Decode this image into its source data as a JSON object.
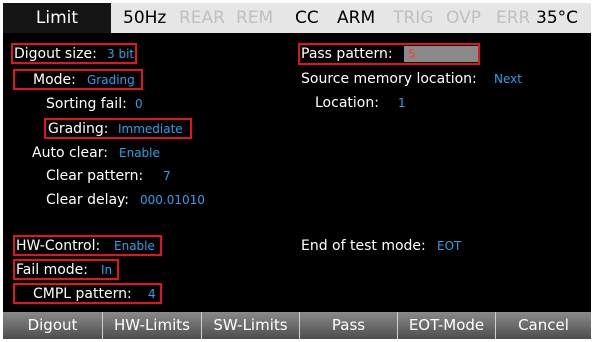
{
  "status": {
    "title": "Limit",
    "freq": "50Hz",
    "rear": "REAR",
    "rem": "REM",
    "cc": "CC",
    "arm": "ARM",
    "trig": "TRIG",
    "ovp": "OVP",
    "err": "ERR",
    "temp": "35°C"
  },
  "settings": {
    "digout_size_label": "Digout size:",
    "digout_size_value": "3 bit",
    "mode_label": "Mode:",
    "mode_value": "Grading",
    "sorting_fail_label": "Sorting fail:",
    "sorting_fail_value": "0",
    "grading_label": "Grading:",
    "grading_value": "Immediate",
    "auto_clear_label": "Auto clear:",
    "auto_clear_value": "Enable",
    "clear_pattern_label": "Clear pattern:",
    "clear_pattern_value": "7",
    "clear_delay_label": "Clear delay:",
    "clear_delay_value": "000.01010",
    "pass_pattern_label": "Pass pattern:",
    "pass_pattern_value": "5",
    "source_memory_label": "Source memory location:",
    "source_memory_value": "Next",
    "location_label": "Location:",
    "location_value": "1",
    "hw_control_label": "HW-Control:",
    "hw_control_value": "Enable",
    "fail_mode_label": "Fail mode:",
    "fail_mode_value": "In",
    "cmpl_pattern_label": "CMPL pattern:",
    "cmpl_pattern_value": "4",
    "end_of_test_label": "End of test mode:",
    "end_of_test_value": "EOT"
  },
  "softkeys": [
    "Digout",
    "HW-Limits",
    "SW-Limits",
    "Pass",
    "EOT-Mode",
    "Cancel"
  ],
  "colors": {
    "value_blue": "#2f9fe6",
    "highlight_red": "#e0161e",
    "background": "#000000"
  }
}
